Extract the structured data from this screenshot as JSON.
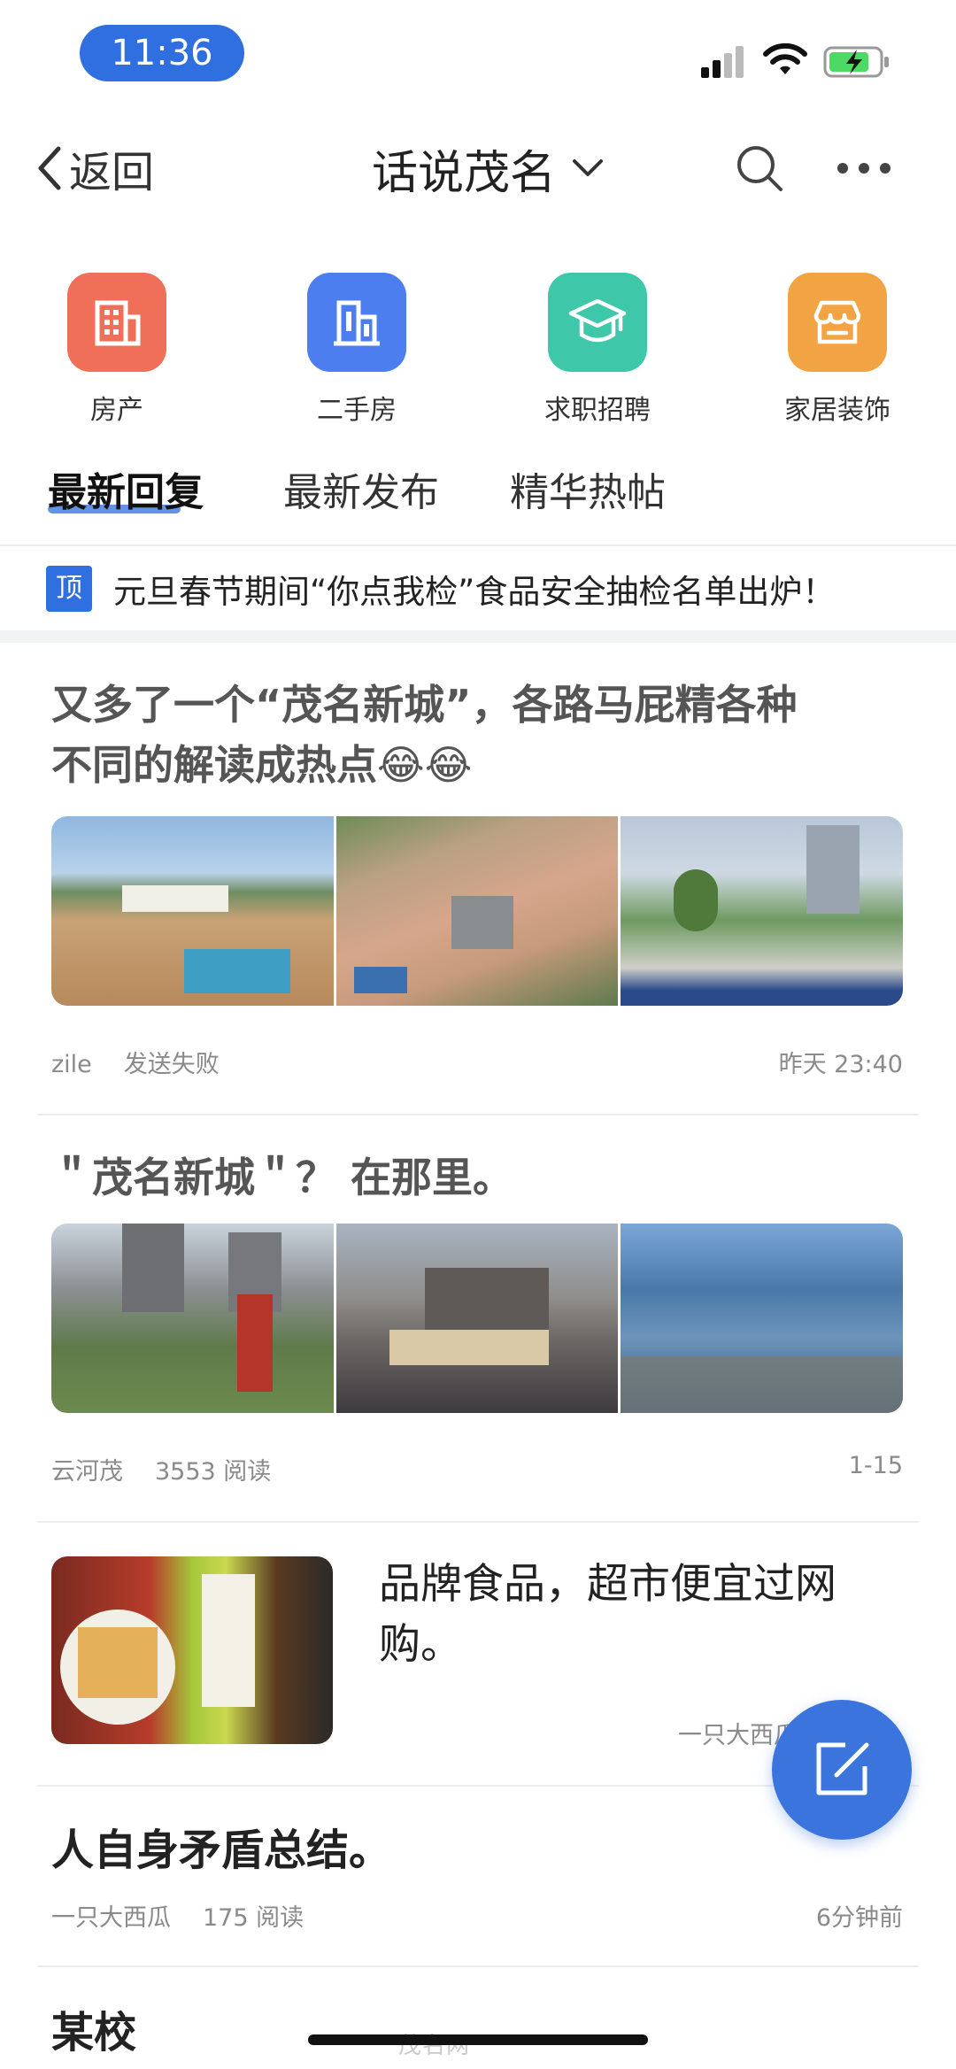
{
  "status_bar": {
    "time": "11:36"
  },
  "nav": {
    "back_label": "返回",
    "title": "话说茂名"
  },
  "categories": [
    {
      "label": "房产",
      "icon": "building-icon",
      "color": "#ef6f58"
    },
    {
      "label": "二手房",
      "icon": "apartment-icon",
      "color": "#4d7ef0"
    },
    {
      "label": "求职招聘",
      "icon": "graduation-cap-icon",
      "color": "#3ec7a9"
    },
    {
      "label": "家居装饰",
      "icon": "storefront-icon",
      "color": "#f2a444"
    }
  ],
  "tabs": [
    {
      "label": "最新回复",
      "active": true
    },
    {
      "label": "最新发布",
      "active": false
    },
    {
      "label": "精华热帖",
      "active": false
    }
  ],
  "pinned": {
    "badge": "顶",
    "text": "元旦春节期间“你点我检”食品安全抽检名单出炉！"
  },
  "posts": [
    {
      "title_line1": "又多了一个“茂名新城”，各路马屁精各种",
      "title_line2": "不同的解读成热点😂😂",
      "author": "zile",
      "status": "发送失败",
      "time": "昨天 23:40"
    },
    {
      "title": "＂茂名新城＂？ 在那里。",
      "author": "云河茂",
      "reads": "3553 阅读",
      "time": "1-15"
    },
    {
      "title": "品牌食品，超市便宜过网购。",
      "meta": "一只大西瓜    读"
    },
    {
      "title": "人自身矛盾总结。",
      "author": "一只大西瓜",
      "reads": "175 阅读",
      "time": "6分钟前"
    },
    {
      "title": "某校"
    }
  ],
  "watermark": "茂名网"
}
